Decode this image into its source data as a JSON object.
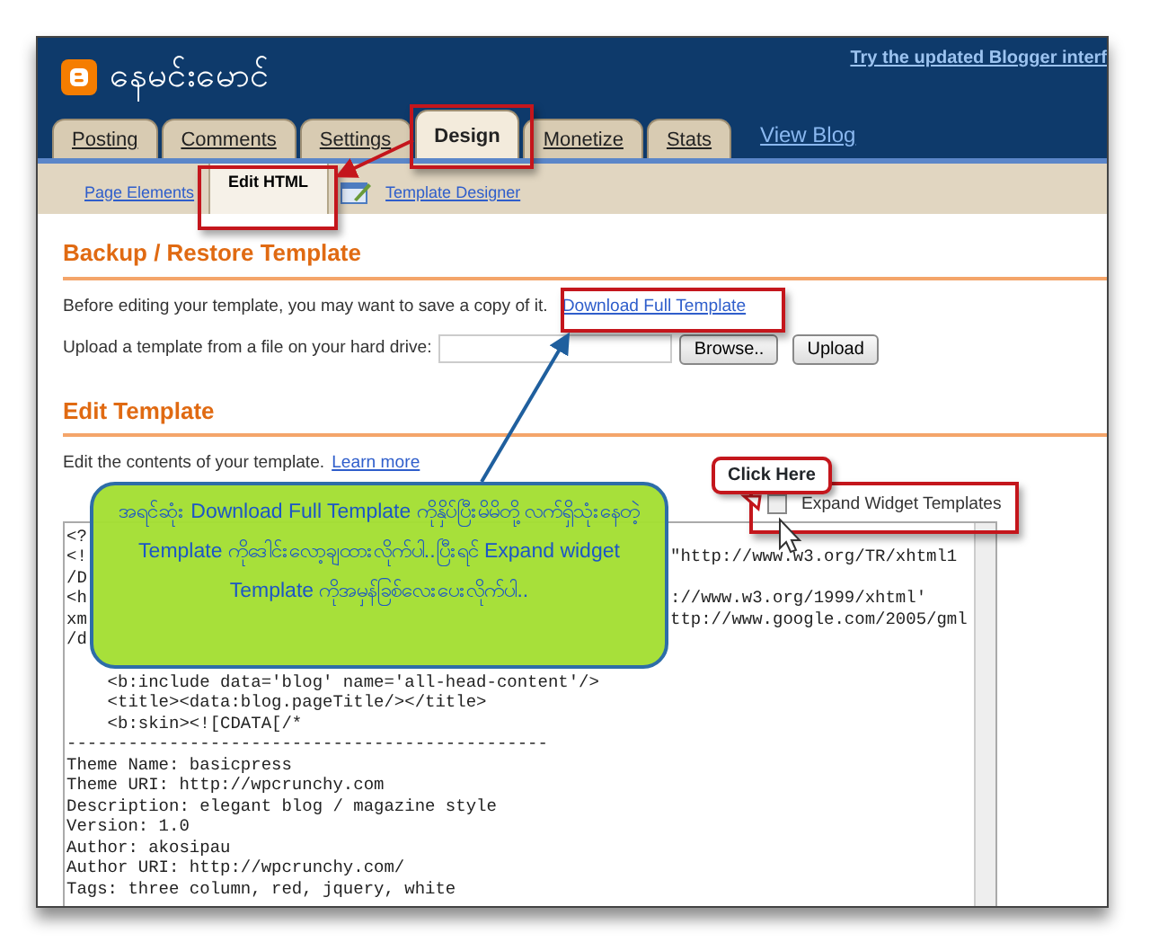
{
  "header": {
    "blog_title": "နေမင်းမောင်",
    "top_link": "Try the updated Blogger interf"
  },
  "tabs": [
    {
      "label": "Posting",
      "selected": false
    },
    {
      "label": "Comments",
      "selected": false
    },
    {
      "label": "Settings",
      "selected": false
    },
    {
      "label": "Design",
      "selected": true
    },
    {
      "label": "Monetize",
      "selected": false
    },
    {
      "label": "Stats",
      "selected": false
    }
  ],
  "view_blog": "View Blog",
  "subtabs": [
    {
      "label": "Page Elements",
      "selected": false,
      "kind": "link"
    },
    {
      "label": "Edit HTML",
      "selected": true,
      "kind": "link"
    },
    {
      "label": "Template Designer",
      "selected": false,
      "kind": "designer"
    }
  ],
  "backup": {
    "heading": "Backup / Restore Template",
    "intro": "Before editing your template, you may want to save a copy of it.",
    "download_link": "Download Full Template",
    "upload_label": "Upload a template from a file on your hard drive:",
    "browse_button": "Browse..",
    "upload_button": "Upload"
  },
  "edit": {
    "heading": "Edit Template",
    "intro": "Edit the contents of your template.",
    "learn_more": "Learn more",
    "expand": {
      "label": "Expand Widget Templates",
      "checked": false
    },
    "code_lines": [
      {
        "text": "<?"
      },
      {
        "text": "<!",
        "tail": "\"http://www.w3.org/TR/xhtml1"
      },
      {
        "text": "/D"
      },
      {
        "text": "<h",
        "tail": "://www.w3.org/1999/xhtml'"
      },
      {
        "text": "xm",
        "tail": "ttp://www.google.com/2005/gml"
      },
      {
        "text": "/d"
      },
      {
        "text": "    <b:include data='blog' name='all-head-content'/>"
      },
      {
        "text": "    <title><data:blog.pageTitle/></title>"
      },
      {
        "text": "    <b:skin><![CDATA[/*"
      },
      {
        "text": "-----------------------------------------------"
      },
      {
        "text": "Theme Name: basicpress"
      },
      {
        "text": "Theme URI: http://wpcrunchy.com"
      },
      {
        "text": "Description: elegant blog / magazine style"
      },
      {
        "text": "Version: 1.0"
      },
      {
        "text": "Author: akosipau"
      },
      {
        "text": "Author URI: http://wpcrunchy.com/"
      },
      {
        "text": "Tags: three column, red, jquery, white"
      }
    ]
  },
  "annotations": {
    "click_here": "Click Here",
    "callout": "အရင်ဆုံး Download Full Template ကိုနှိပ်ပြီးမိမိတို့ လက်ရှိသုံးနေတဲ့ Template ကိုဒေါင်းလော့ချထားလိုက်ပါ..ပြီးရင် Expand widget Template ကိုအမှန်ခြစ်လေးပေးလိုက်ပါ.."
  }
}
